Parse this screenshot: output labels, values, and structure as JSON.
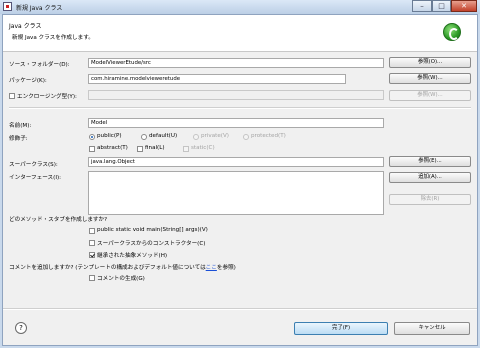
{
  "window": {
    "title": "新規 Java クラス",
    "minimize": "–",
    "maximize": "□",
    "close": "✕"
  },
  "header": {
    "title": "Java クラス",
    "subtitle": "新規 Java クラスを作成します。"
  },
  "form": {
    "source_folder": {
      "label": "ソース・フォルダー(D):",
      "value": "ModelViewerEtude/src",
      "button": "参照(O)..."
    },
    "package": {
      "label": "パッケージ(K):",
      "value": "com.hiramine.modelvieweretude",
      "button": "参照(W)..."
    },
    "enclosing": {
      "label": "エンクロージング型(Y):",
      "value": "",
      "button": "参照(W)..."
    },
    "name": {
      "label": "名前(M):",
      "value": "Model"
    },
    "modifiers": {
      "label": "修飾子:",
      "radios": [
        {
          "label": "public(P)",
          "selected": true,
          "enabled": true
        },
        {
          "label": "default(U)",
          "selected": false,
          "enabled": true
        },
        {
          "label": "private(V)",
          "selected": false,
          "enabled": false
        },
        {
          "label": "protected(T)",
          "selected": false,
          "enabled": false
        }
      ],
      "checks": [
        {
          "label": "abstract(T)",
          "checked": false,
          "enabled": true
        },
        {
          "label": "final(L)",
          "checked": false,
          "enabled": true
        },
        {
          "label": "static(C)",
          "checked": false,
          "enabled": false
        }
      ]
    },
    "superclass": {
      "label": "スーパークラス(S):",
      "value": "java.lang.Object",
      "button": "参照(E)..."
    },
    "interfaces": {
      "label": "インターフェース(I):",
      "add_button": "追加(A)...",
      "remove_button": "除去(R)"
    }
  },
  "stubs": {
    "question": "どのメソッド・スタブを作成しますか?",
    "items": [
      {
        "label": "public static void main(String[] args)(V)",
        "checked": false
      },
      {
        "label": "スーパークラスからのコンストラクター(C)",
        "checked": false
      },
      {
        "label": "継承された抽象メソッド(H)",
        "checked": true
      }
    ]
  },
  "comments": {
    "question_prefix": "コメントを追加しますか? (テンプレートの構成およびデフォルト値については",
    "link": "ここ",
    "question_suffix": "を参照)",
    "generate_label": "コメントの生成(G)"
  },
  "footer": {
    "help": "?",
    "finish": "完了(F)",
    "cancel": "キャンセル"
  },
  "colors": {
    "link": "#1a4fd6",
    "accent": "#3c7fb1"
  }
}
